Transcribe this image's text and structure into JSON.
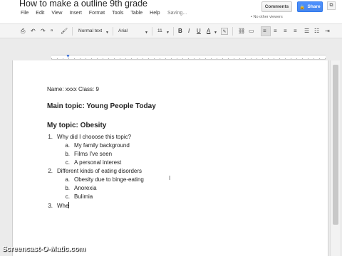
{
  "header": {
    "doc_title": "How to make a outline 9th grade",
    "star_icon": "star-icon",
    "menu": [
      "File",
      "Edit",
      "View",
      "Insert",
      "Format",
      "Tools",
      "Table",
      "Help"
    ],
    "status": "Saving...",
    "comments_label": "Comments",
    "share_label": "Share",
    "viewers_text": "No other viewers"
  },
  "toolbar": {
    "style_label": "Normal text",
    "font_label": "Arial",
    "size_label": "11",
    "bold_label": "B",
    "italic_label": "I",
    "underline_label": "U",
    "color_label": "A"
  },
  "document": {
    "name_line": "Name: xxxx Class: 9",
    "main_topic": "Main topic: Young People Today",
    "my_topic": "My topic: Obesity",
    "items": [
      {
        "num": "1.",
        "text": "Why did I chooose this topic?",
        "sub": [
          {
            "num": "a.",
            "text": "My family background"
          },
          {
            "num": "b.",
            "text": "Films I've seen"
          },
          {
            "num": "c.",
            "text": "A personal interest"
          }
        ]
      },
      {
        "num": "2.",
        "text": "Different kinds of eating disorders",
        "sub": [
          {
            "num": "a.",
            "text": "Obesity due to binge-eating"
          },
          {
            "num": "b.",
            "text": "Anorexia"
          },
          {
            "num": "c.",
            "text": "Bulimia"
          }
        ]
      },
      {
        "num": "3.",
        "text": "Whe"
      }
    ]
  },
  "watermark": "Screencast-O-Matic.com"
}
